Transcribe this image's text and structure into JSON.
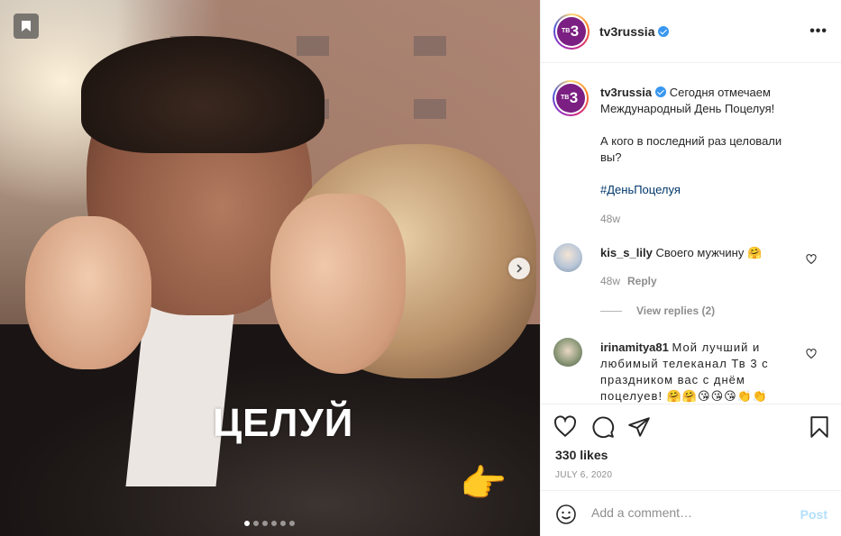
{
  "media": {
    "overlay_text": "ЦЕЛУЙ",
    "carousel": {
      "total": 6,
      "active": 1
    }
  },
  "post": {
    "username": "tv3russia",
    "verified": true,
    "logo_big": "3",
    "logo_small": "ТВ",
    "more_label": "•••"
  },
  "caption": {
    "username": "tv3russia",
    "line1": "Сегодня отмечаем Международный День Поцелуя!",
    "line2": "А кого в последний раз целовали вы?",
    "hashtag": "#ДеньПоцелуя",
    "time": "48w"
  },
  "comments": [
    {
      "username": "kis_s_lily",
      "text": "Своего мужчину 🤗",
      "time": "48w",
      "reply_label": "Reply",
      "view_replies": "View replies (2)"
    },
    {
      "username": "irinamitya81",
      "text": "Мой лучший и любимый телеканал Тв 3 с праздником вас с днём поцелуев! 🤗🤗😘😘😘👏👏"
    }
  ],
  "actions": {
    "likes": "330 likes",
    "date": "JULY 6, 2020"
  },
  "add_comment": {
    "placeholder": "Add a comment…",
    "post_label": "Post"
  },
  "colors": {
    "verified": "#3897f0",
    "logo_bg": "#7b1f82",
    "hashtag": "#00376b",
    "post_disabled": "#b2dffc"
  },
  "icons": [
    "bookmark-icon",
    "chevron-right-icon",
    "more-icon",
    "heart-icon",
    "comment-icon",
    "share-icon",
    "save-icon",
    "smile-icon",
    "verified-icon"
  ]
}
